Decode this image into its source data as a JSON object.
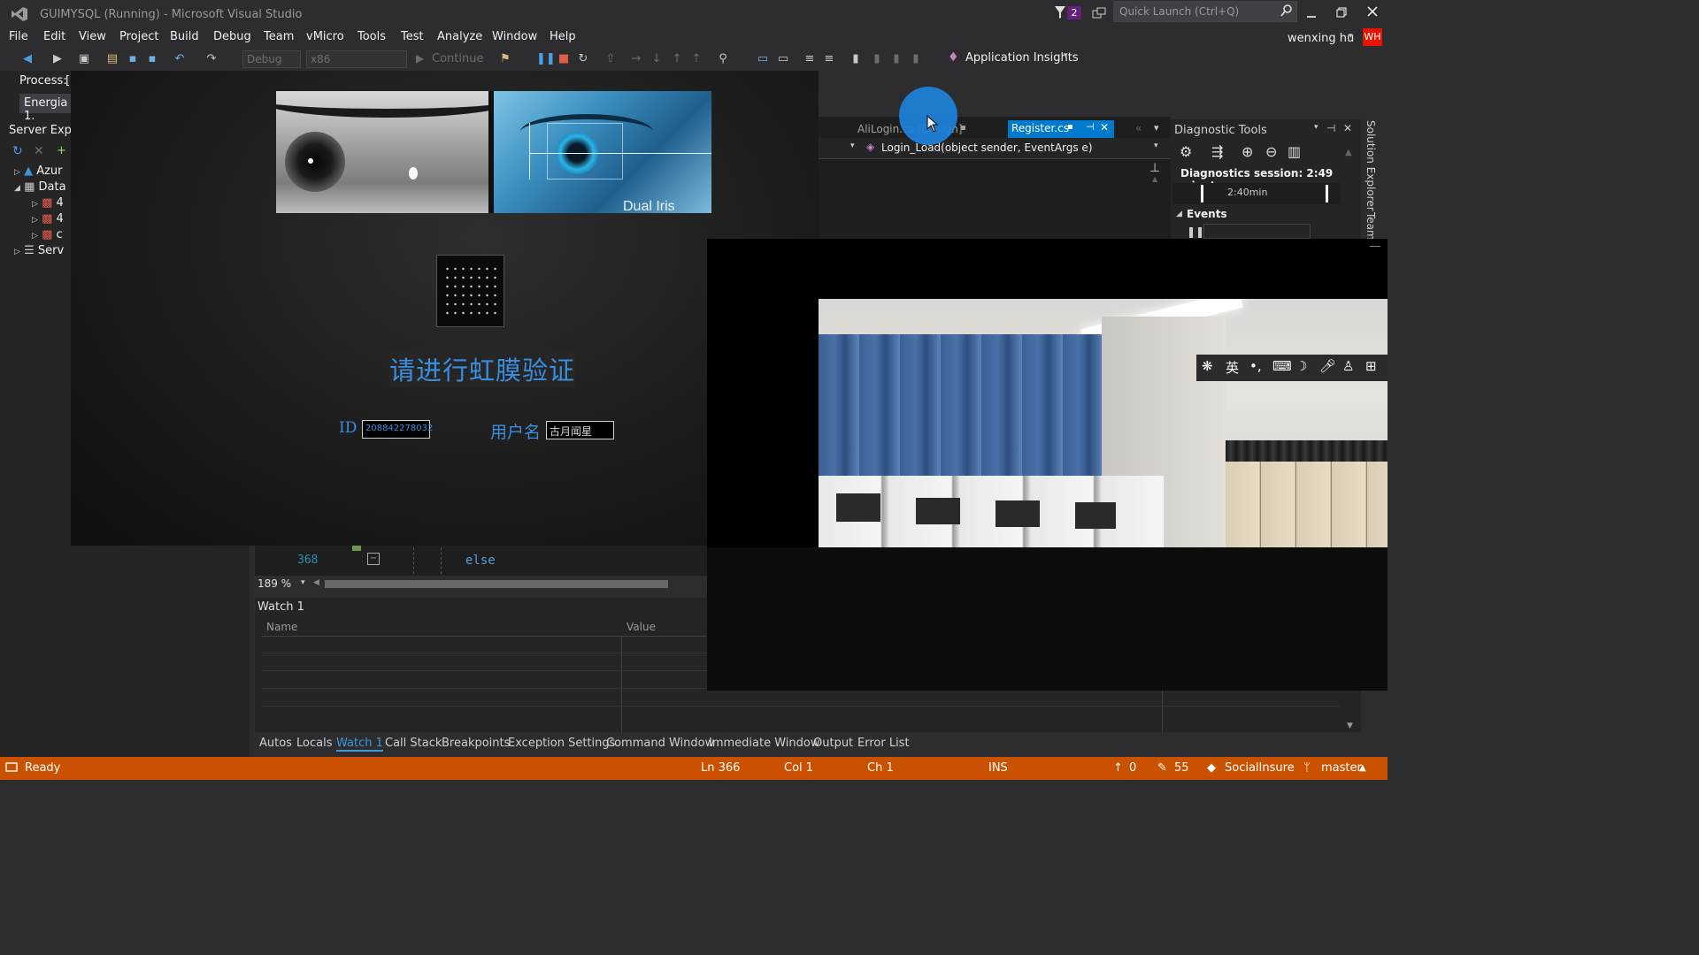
{
  "titlebar": {
    "title": "GUIMYSQL (Running) - Microsoft Visual Studio",
    "notif_count": "2",
    "quick_launch_placeholder": "Quick Launch (Ctrl+Q)",
    "user_name": "wenxing hu",
    "user_initials": "WH"
  },
  "menu": [
    "File",
    "Edit",
    "View",
    "Project",
    "Build",
    "Debug",
    "Team",
    "vMicro",
    "Tools",
    "Test",
    "Analyze",
    "Window",
    "Help"
  ],
  "toolbar": {
    "config": "Debug",
    "platform": "x86",
    "continue_label": "Continue",
    "app_insights": "Application Insights"
  },
  "side": {
    "process_label": "Process:",
    "process_value": "[",
    "energia": "Energia 1.",
    "server_explorer": "Server Explor",
    "tree": [
      "Azur",
      "Data",
      "4",
      "4",
      "c",
      "Serv"
    ]
  },
  "editor": {
    "tabs": [
      {
        "label": "AliLogin.cs [Design]",
        "active": false
      },
      {
        "label": "Register.cs",
        "active": true
      }
    ],
    "method_dropdown": "Login_Load(object sender, EventArgs e)",
    "line_number": "368",
    "code": "else",
    "zoom": "189 %"
  },
  "diagnostics": {
    "title": "Diagnostic Tools",
    "session": "Diagnostics session: 2:49 minut...",
    "timeline": "2:40min",
    "events": "Events"
  },
  "right_vertical": [
    "Solution Explorer",
    "Team"
  ],
  "watch": {
    "title": "Watch 1",
    "col_name": "Name",
    "col_value": "Value"
  },
  "tool_tabs": [
    "Autos",
    "Locals",
    "Watch 1",
    "Call Stack",
    "Breakpoints",
    "Exception Settings",
    "Command Window",
    "Immediate Window",
    "Output",
    "Error List"
  ],
  "iris_app": {
    "banner_text": "Dual Iris",
    "prompt": "请进行虹膜验证",
    "id_label": "ID",
    "id_value": "208842278032",
    "username_label": "用户名",
    "username_value": "古月闻星"
  },
  "status": {
    "ready": "Ready",
    "ln": "Ln 366",
    "col": "Col 1",
    "ch": "Ch 1",
    "ins": "INS",
    "up": "0",
    "pencil": "55",
    "repo": "SocialInsure",
    "branch": "master"
  },
  "colors": {
    "accent": "#007acc",
    "status_bar": "#ca5100",
    "prompt_blue": "#3a8ee0",
    "user_badge": "#e51400"
  }
}
